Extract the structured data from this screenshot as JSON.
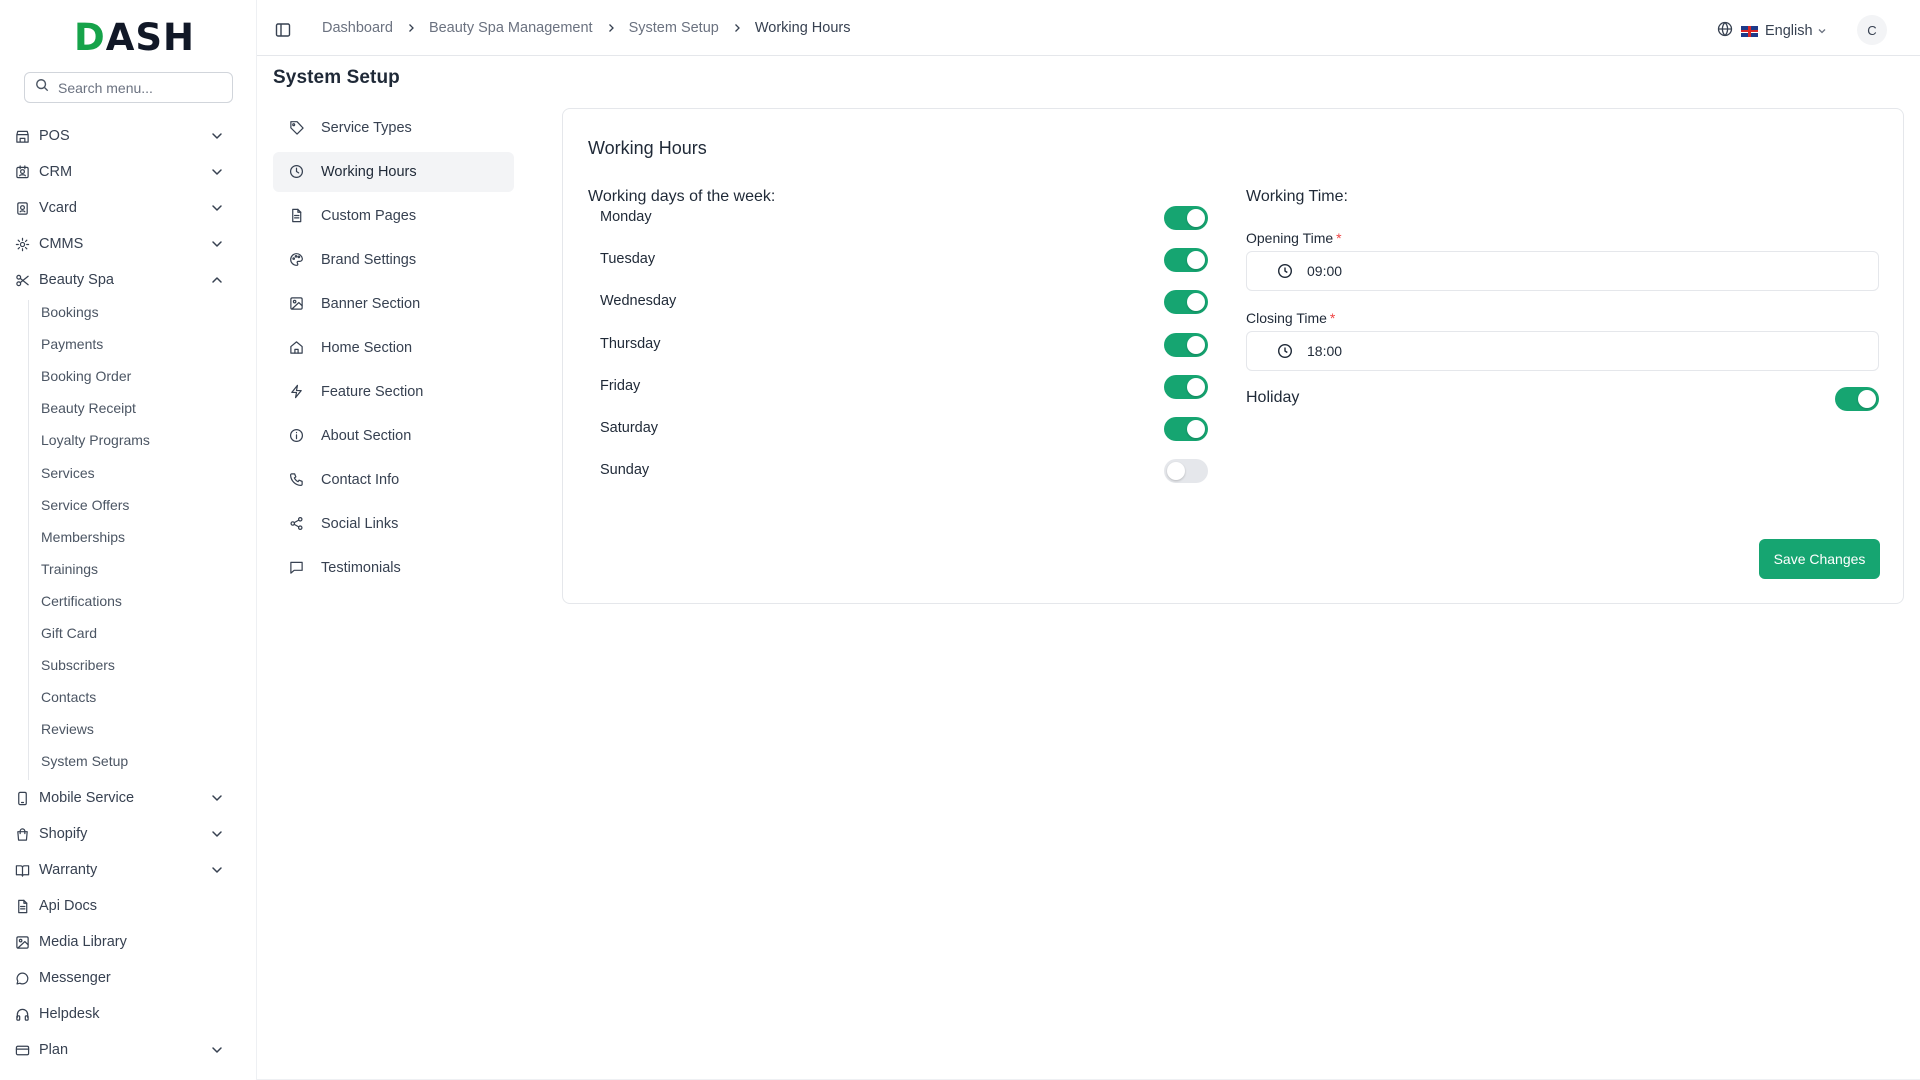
{
  "brand": {
    "logo_text_a": "D",
    "logo_text_b": "ASH"
  },
  "search": {
    "placeholder": "Search menu..."
  },
  "sidebar": {
    "items": [
      {
        "label": "POS",
        "icon": "store-icon",
        "chevron": "down"
      },
      {
        "label": "CRM",
        "icon": "contact-card-icon",
        "chevron": "down"
      },
      {
        "label": "Vcard",
        "icon": "badge-icon",
        "chevron": "down"
      },
      {
        "label": "CMMS",
        "icon": "gear-icon",
        "chevron": "down"
      },
      {
        "label": "Beauty Spa",
        "icon": "scissors-icon",
        "chevron": "up"
      }
    ],
    "beauty_spa_children": [
      "Bookings",
      "Payments",
      "Booking Order",
      "Beauty Receipt",
      "Loyalty Programs",
      "Services",
      "Service Offers",
      "Memberships",
      "Trainings",
      "Certifications",
      "Gift Card",
      "Subscribers",
      "Contacts",
      "Reviews",
      "System Setup"
    ],
    "lower_items": [
      {
        "label": "Mobile Service",
        "icon": "mobile-icon",
        "chevron": "down"
      },
      {
        "label": "Shopify",
        "icon": "shopping-bag-icon",
        "chevron": "down"
      },
      {
        "label": "Warranty",
        "icon": "book-icon",
        "chevron": "down"
      },
      {
        "label": "Api Docs",
        "icon": "document-icon",
        "chevron": ""
      },
      {
        "label": "Media Library",
        "icon": "image-icon",
        "chevron": ""
      },
      {
        "label": "Messenger",
        "icon": "chat-icon",
        "chevron": ""
      },
      {
        "label": "Helpdesk",
        "icon": "headset-icon",
        "chevron": ""
      },
      {
        "label": "Plan",
        "icon": "credit-card-icon",
        "chevron": "down"
      }
    ]
  },
  "header": {
    "breadcrumb": [
      "Dashboard",
      "Beauty Spa Management",
      "System Setup",
      "Working Hours"
    ],
    "language": "English",
    "avatar_initial": "C"
  },
  "page": {
    "title": "System Setup",
    "submenu": [
      {
        "label": "Service Types",
        "icon": "tag-icon",
        "active": false
      },
      {
        "label": "Working Hours",
        "icon": "clock-icon",
        "active": true
      },
      {
        "label": "Custom Pages",
        "icon": "file-icon",
        "active": false
      },
      {
        "label": "Brand Settings",
        "icon": "palette-icon",
        "active": false
      },
      {
        "label": "Banner Section",
        "icon": "image-icon",
        "active": false
      },
      {
        "label": "Home Section",
        "icon": "home-icon",
        "active": false
      },
      {
        "label": "Feature Section",
        "icon": "bolt-icon",
        "active": false
      },
      {
        "label": "About Section",
        "icon": "info-icon",
        "active": false
      },
      {
        "label": "Contact Info",
        "icon": "phone-icon",
        "active": false
      },
      {
        "label": "Social Links",
        "icon": "share-icon",
        "active": false
      },
      {
        "label": "Testimonials",
        "icon": "message-icon",
        "active": false
      }
    ]
  },
  "card": {
    "title": "Working Hours",
    "days_title": "Working days of the week:",
    "days": [
      {
        "label": "Monday",
        "on": true
      },
      {
        "label": "Tuesday",
        "on": true
      },
      {
        "label": "Wednesday",
        "on": true
      },
      {
        "label": "Thursday",
        "on": true
      },
      {
        "label": "Friday",
        "on": true
      },
      {
        "label": "Saturday",
        "on": true
      },
      {
        "label": "Sunday",
        "on": false
      }
    ],
    "time_title": "Working Time:",
    "opening_label": "Opening Time",
    "opening_value": "09:00",
    "closing_label": "Closing Time",
    "closing_value": "18:00",
    "required_mark": "*",
    "holiday_label": "Holiday",
    "holiday_on": true,
    "save_label": "Save Changes"
  },
  "colors": {
    "accent": "#16a571",
    "brand_green": "#16a34a"
  }
}
